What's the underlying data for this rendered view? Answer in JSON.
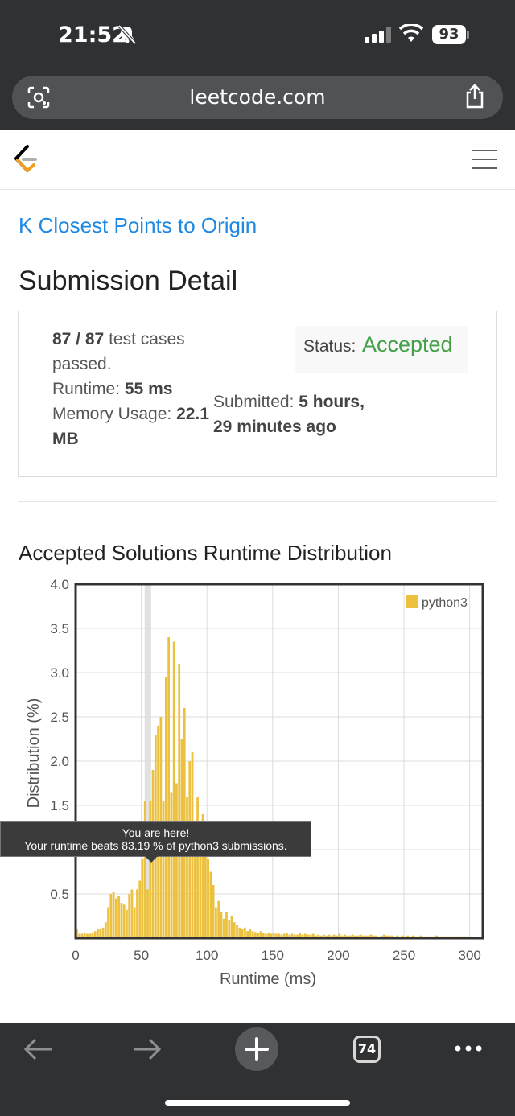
{
  "status_bar": {
    "time": "21:52",
    "battery": "93"
  },
  "browser": {
    "url": "leetcode.com",
    "tab_count": "74"
  },
  "problem": {
    "title": "K Closest Points to Origin"
  },
  "page": {
    "heading": "Submission Detail"
  },
  "submission": {
    "cases_passed": "87 / 87",
    "cases_suffix_1": "test cases",
    "cases_suffix_2": "passed.",
    "runtime_label": "Runtime:",
    "runtime_value": "55 ms",
    "memory_label": "Memory Usage:",
    "memory_value_1": "22.1",
    "memory_value_2": "MB",
    "submitted_label": "Submitted:",
    "submitted_value_1": "5 hours,",
    "submitted_value_2": "29 minutes ago",
    "status_label": "Status:",
    "status_value": "Accepted"
  },
  "chart_title": "Accepted Solutions Runtime Distribution",
  "tooltip": {
    "line1": "You are here!",
    "line2": "Your runtime beats 83.19 % of python3 submissions."
  },
  "colors": {
    "accent_link": "#1e88e5",
    "accepted": "#43a047",
    "bar": "#ecc140",
    "chrome": "#2f3133"
  },
  "icons": [
    "bell-slash-icon",
    "signal-icon",
    "wifi-icon",
    "battery-icon",
    "lens-icon",
    "share-icon",
    "leetcode-logo",
    "menu-icon",
    "back-icon",
    "forward-icon",
    "plus-icon",
    "tabs-icon",
    "more-icon"
  ],
  "chart_data": {
    "type": "bar",
    "title": "",
    "xlabel": "Runtime (ms)",
    "ylabel": "Distribution (%)",
    "xlim": [
      0,
      310
    ],
    "ylim": [
      0,
      4.0
    ],
    "xticks": [
      0,
      50,
      100,
      150,
      200,
      250,
      300
    ],
    "yticks": [
      0.5,
      1.0,
      1.5,
      2.0,
      2.5,
      3.0,
      3.5,
      4.0
    ],
    "grid": true,
    "legend": "top-right",
    "highlight_x": 55,
    "series": [
      {
        "name": "python3",
        "color": "#ecc140",
        "points": [
          [
            1,
            0.1
          ],
          [
            3,
            0.05
          ],
          [
            5,
            0.05
          ],
          [
            7,
            0.06
          ],
          [
            9,
            0.05
          ],
          [
            11,
            0.05
          ],
          [
            13,
            0.06
          ],
          [
            15,
            0.08
          ],
          [
            17,
            0.1
          ],
          [
            19,
            0.1
          ],
          [
            21,
            0.12
          ],
          [
            23,
            0.18
          ],
          [
            25,
            0.35
          ],
          [
            27,
            0.5
          ],
          [
            29,
            0.52
          ],
          [
            31,
            0.45
          ],
          [
            33,
            0.48
          ],
          [
            35,
            0.4
          ],
          [
            37,
            0.38
          ],
          [
            39,
            0.32
          ],
          [
            41,
            0.5
          ],
          [
            43,
            0.55
          ],
          [
            45,
            0.35
          ],
          [
            47,
            0.55
          ],
          [
            49,
            0.65
          ],
          [
            51,
            0.9
          ],
          [
            53,
            1.55
          ],
          [
            55,
            0.55
          ],
          [
            57,
            1.55
          ],
          [
            59,
            1.9
          ],
          [
            61,
            2.3
          ],
          [
            63,
            2.4
          ],
          [
            65,
            2.5
          ],
          [
            67,
            1.55
          ],
          [
            69,
            2.95
          ],
          [
            71,
            3.4
          ],
          [
            73,
            1.65
          ],
          [
            75,
            3.35
          ],
          [
            77,
            1.75
          ],
          [
            79,
            3.1
          ],
          [
            81,
            2.25
          ],
          [
            83,
            2.6
          ],
          [
            85,
            1.6
          ],
          [
            87,
            2.0
          ],
          [
            89,
            2.1
          ],
          [
            91,
            1.3
          ],
          [
            93,
            1.6
          ],
          [
            95,
            1.2
          ],
          [
            97,
            1.4
          ],
          [
            99,
            1.0
          ],
          [
            101,
            0.9
          ],
          [
            103,
            0.75
          ],
          [
            105,
            0.6
          ],
          [
            107,
            0.35
          ],
          [
            109,
            0.42
          ],
          [
            111,
            0.3
          ],
          [
            113,
            0.22
          ],
          [
            115,
            0.3
          ],
          [
            117,
            0.2
          ],
          [
            119,
            0.25
          ],
          [
            121,
            0.18
          ],
          [
            123,
            0.15
          ],
          [
            125,
            0.12
          ],
          [
            127,
            0.1
          ],
          [
            129,
            0.12
          ],
          [
            131,
            0.08
          ],
          [
            133,
            0.1
          ],
          [
            135,
            0.08
          ],
          [
            137,
            0.07
          ],
          [
            139,
            0.06
          ],
          [
            141,
            0.08
          ],
          [
            143,
            0.06
          ],
          [
            145,
            0.05
          ],
          [
            147,
            0.06
          ],
          [
            149,
            0.05
          ],
          [
            151,
            0.06
          ],
          [
            153,
            0.05
          ],
          [
            155,
            0.05
          ],
          [
            157,
            0.04
          ],
          [
            159,
            0.05
          ],
          [
            161,
            0.06
          ],
          [
            163,
            0.04
          ],
          [
            165,
            0.05
          ],
          [
            167,
            0.04
          ],
          [
            169,
            0.04
          ],
          [
            171,
            0.06
          ],
          [
            173,
            0.04
          ],
          [
            175,
            0.05
          ],
          [
            177,
            0.04
          ],
          [
            179,
            0.04
          ],
          [
            181,
            0.05
          ],
          [
            183,
            0.03
          ],
          [
            185,
            0.04
          ],
          [
            187,
            0.03
          ],
          [
            189,
            0.04
          ],
          [
            191,
            0.03
          ],
          [
            193,
            0.04
          ],
          [
            195,
            0.03
          ],
          [
            197,
            0.04
          ],
          [
            199,
            0.03
          ],
          [
            201,
            0.05
          ],
          [
            203,
            0.03
          ],
          [
            205,
            0.04
          ],
          [
            207,
            0.03
          ],
          [
            209,
            0.03
          ],
          [
            211,
            0.04
          ],
          [
            213,
            0.03
          ],
          [
            215,
            0.03
          ],
          [
            217,
            0.04
          ],
          [
            219,
            0.03
          ],
          [
            221,
            0.03
          ],
          [
            223,
            0.03
          ],
          [
            225,
            0.04
          ],
          [
            227,
            0.03
          ],
          [
            229,
            0.03
          ],
          [
            231,
            0.02
          ],
          [
            233,
            0.03
          ],
          [
            235,
            0.04
          ],
          [
            237,
            0.03
          ],
          [
            239,
            0.03
          ],
          [
            241,
            0.03
          ],
          [
            243,
            0.02
          ],
          [
            245,
            0.03
          ],
          [
            247,
            0.02
          ],
          [
            249,
            0.03
          ],
          [
            251,
            0.02
          ],
          [
            253,
            0.03
          ],
          [
            255,
            0.02
          ],
          [
            257,
            0.03
          ],
          [
            259,
            0.02
          ],
          [
            261,
            0.02
          ],
          [
            263,
            0.03
          ],
          [
            265,
            0.02
          ],
          [
            267,
            0.02
          ],
          [
            269,
            0.02
          ],
          [
            271,
            0.02
          ],
          [
            273,
            0.02
          ],
          [
            275,
            0.03
          ],
          [
            277,
            0.02
          ],
          [
            279,
            0.02
          ],
          [
            281,
            0.02
          ],
          [
            283,
            0.02
          ],
          [
            285,
            0.02
          ],
          [
            287,
            0.02
          ],
          [
            289,
            0.02
          ],
          [
            291,
            0.02
          ],
          [
            293,
            0.02
          ],
          [
            295,
            0.02
          ],
          [
            297,
            0.02
          ],
          [
            299,
            0.02
          ]
        ]
      }
    ]
  }
}
